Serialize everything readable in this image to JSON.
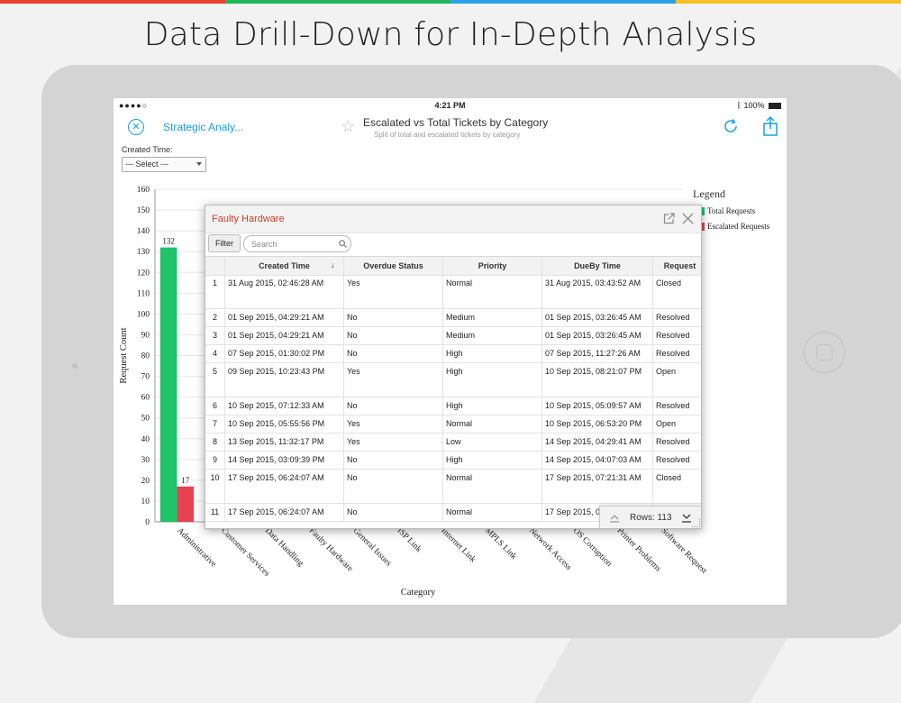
{
  "headline": "Data Drill-Down for In-Depth Analysis",
  "brand_colors": [
    "#e8412c",
    "#1fb75a",
    "#2aa3e6",
    "#f6c12a"
  ],
  "status_bar": {
    "signal": "●●●●○",
    "time": "4:21 PM",
    "battery": "100%"
  },
  "nav": {
    "back_label": "Strategic Analy...",
    "title": "Escalated vs Total Tickets by Category",
    "subtitle": "Split of total and escalated tickets by category"
  },
  "filter": {
    "label": "Created Time:",
    "selected": "--- Select ---"
  },
  "chart_data": {
    "type": "bar",
    "xlabel": "Category",
    "ylabel": "Request Count",
    "ylim": [
      0,
      160
    ],
    "y_ticks": [
      0,
      10,
      20,
      30,
      40,
      50,
      60,
      70,
      80,
      90,
      100,
      110,
      120,
      130,
      140,
      150,
      160
    ],
    "categories": [
      "Administrative",
      "Customer Services",
      "Data Handling",
      "Faulty Hardware",
      "General Issues",
      "ISP Link",
      "Internet Link",
      "MPLS Link",
      "Network Access",
      "OS Corruption",
      "Printer Problems",
      "Software Request"
    ],
    "series": [
      {
        "name": "Total Requests",
        "color": "#1ec36a",
        "values": [
          132,
          null,
          null,
          null,
          null,
          null,
          null,
          null,
          null,
          null,
          null,
          null
        ]
      },
      {
        "name": "Escalated Requests",
        "color": "#e5414f",
        "values": [
          17,
          null,
          null,
          null,
          null,
          null,
          null,
          null,
          null,
          null,
          null,
          null
        ]
      }
    ],
    "data_labels": [
      "132",
      "17"
    ],
    "legend": {
      "title": "Legend",
      "position": "right"
    }
  },
  "popup": {
    "title": "Faulty Hardware",
    "filter_label": "Filter",
    "search_placeholder": "Search",
    "columns": [
      "",
      "Created Time",
      "Overdue Status",
      "Priority",
      "DueBy Time",
      "Request"
    ],
    "rows": [
      [
        "1",
        "31 Aug 2015, 02:46:28 AM",
        "Yes",
        "Normal",
        "31 Aug 2015, 03:43:52 AM",
        "Closed"
      ],
      [
        "2",
        "01 Sep 2015, 04:29:21 AM",
        "No",
        "Medium",
        "01 Sep 2015, 03:26:45 AM",
        "Resolved"
      ],
      [
        "3",
        "01 Sep 2015, 04:29:21 AM",
        "No",
        "Medium",
        "01 Sep 2015, 03:26:45 AM",
        "Resolved"
      ],
      [
        "4",
        "07 Sep 2015, 01:30:02 PM",
        "No",
        "High",
        "07 Sep 2015, 11:27:26 AM",
        "Resolved"
      ],
      [
        "5",
        "09 Sep 2015, 10:23:43 PM",
        "Yes",
        "High",
        "10 Sep 2015, 08:21:07 PM",
        "Open"
      ],
      [
        "6",
        "10 Sep 2015, 07:12:33 AM",
        "No",
        "High",
        "10 Sep 2015, 05:09:57 AM",
        "Resolved"
      ],
      [
        "7",
        "10 Sep 2015, 05:55:56 PM",
        "Yes",
        "Normal",
        "10 Sep 2015, 06:53:20 PM",
        "Open"
      ],
      [
        "8",
        "13 Sep 2015, 11:32:17 PM",
        "Yes",
        "Low",
        "14 Sep 2015, 04:29:41 AM",
        "Resolved"
      ],
      [
        "9",
        "14 Sep 2015, 03:09:39 PM",
        "No",
        "High",
        "14 Sep 2015, 04:07:03 AM",
        "Resolved"
      ],
      [
        "10",
        "17 Sep 2015, 06:24:07 AM",
        "No",
        "Normal",
        "17 Sep 2015, 07:21:31 AM",
        "Closed"
      ],
      [
        "11",
        "17 Sep 2015, 06:24:07 AM",
        "No",
        "Normal",
        "17 Sep 2015, 0",
        ""
      ]
    ],
    "rows_label": "Rows: 113"
  }
}
